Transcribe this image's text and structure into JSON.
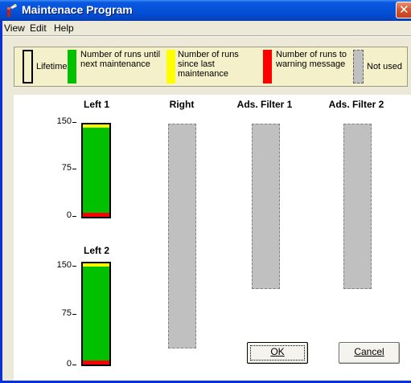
{
  "window": {
    "title": "Maintenace Program",
    "close_glyph": "✕"
  },
  "menu": {
    "items": [
      "View",
      "Edit",
      "Help"
    ]
  },
  "legend": {
    "lifetime": "Lifetime",
    "until_next": "Number of runs until\nnext maintenance",
    "since_last": "Number of runs\nsince last\nmaintenance",
    "to_warning": "Number of runs to\nwarning message",
    "not_used": "Not used"
  },
  "colors": {
    "green": "#00c000",
    "yellow": "#ffff00",
    "red": "#ff0000",
    "unused": "#c0c0c0",
    "window_blue": "#0452d8"
  },
  "columns": {
    "left1": "Left 1",
    "right": "Right",
    "ads1": "Ads. Filter 1",
    "ads2": "Ads. Filter 2",
    "left2": "Left 2"
  },
  "scale": {
    "max": 150,
    "mid": 75,
    "min": 0
  },
  "gauges": {
    "left1": {
      "lifetime": 150,
      "since_last": 5,
      "to_warning": 6,
      "until_next": 139
    },
    "left2": {
      "lifetime": 150,
      "since_last": 5,
      "to_warning": 6,
      "until_next": 139
    }
  },
  "buttons": {
    "ok": "OK",
    "cancel": "Cancel"
  }
}
